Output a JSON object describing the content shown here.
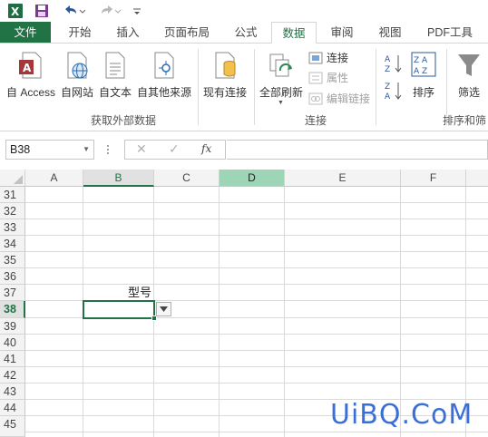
{
  "qat": {
    "icons": [
      "excel-logo-icon",
      "save-icon",
      "undo-icon",
      "redo-icon",
      "customize-icon"
    ]
  },
  "tabs": [
    {
      "label": "文件"
    },
    {
      "label": "开始"
    },
    {
      "label": "插入"
    },
    {
      "label": "页面布局"
    },
    {
      "label": "公式"
    },
    {
      "label": "数据"
    },
    {
      "label": "审阅"
    },
    {
      "label": "视图"
    },
    {
      "label": "PDF工具"
    }
  ],
  "ribbon": {
    "external": {
      "access": "自 Access",
      "web": "自网站",
      "text": "自文本",
      "other": "自其他来源",
      "group": "获取外部数据"
    },
    "existing": "现有连接",
    "connections": {
      "refresh": "全部刷新",
      "connect": "连接",
      "properties": "属性",
      "edit_links": "编辑链接",
      "group": "连接"
    },
    "sort": {
      "sort": "排序",
      "filter": "筛选",
      "group": "排序和筛"
    }
  },
  "formula_bar": {
    "name_box": "B38",
    "cancel": "✕",
    "confirm": "✓",
    "fx": "fx",
    "value": ""
  },
  "grid": {
    "columns": [
      "A",
      "B",
      "C",
      "D",
      "E",
      "F"
    ],
    "rows": [
      "31",
      "32",
      "33",
      "34",
      "35",
      "36",
      "37",
      "38",
      "39",
      "40",
      "41",
      "42",
      "43",
      "44",
      "45"
    ],
    "selected_cell": "B38",
    "cell_b37": "型号"
  },
  "watermark": "UiBQ.CoM",
  "colors": {
    "accent": "#217346",
    "highlight_col": "#9fd5b7"
  }
}
